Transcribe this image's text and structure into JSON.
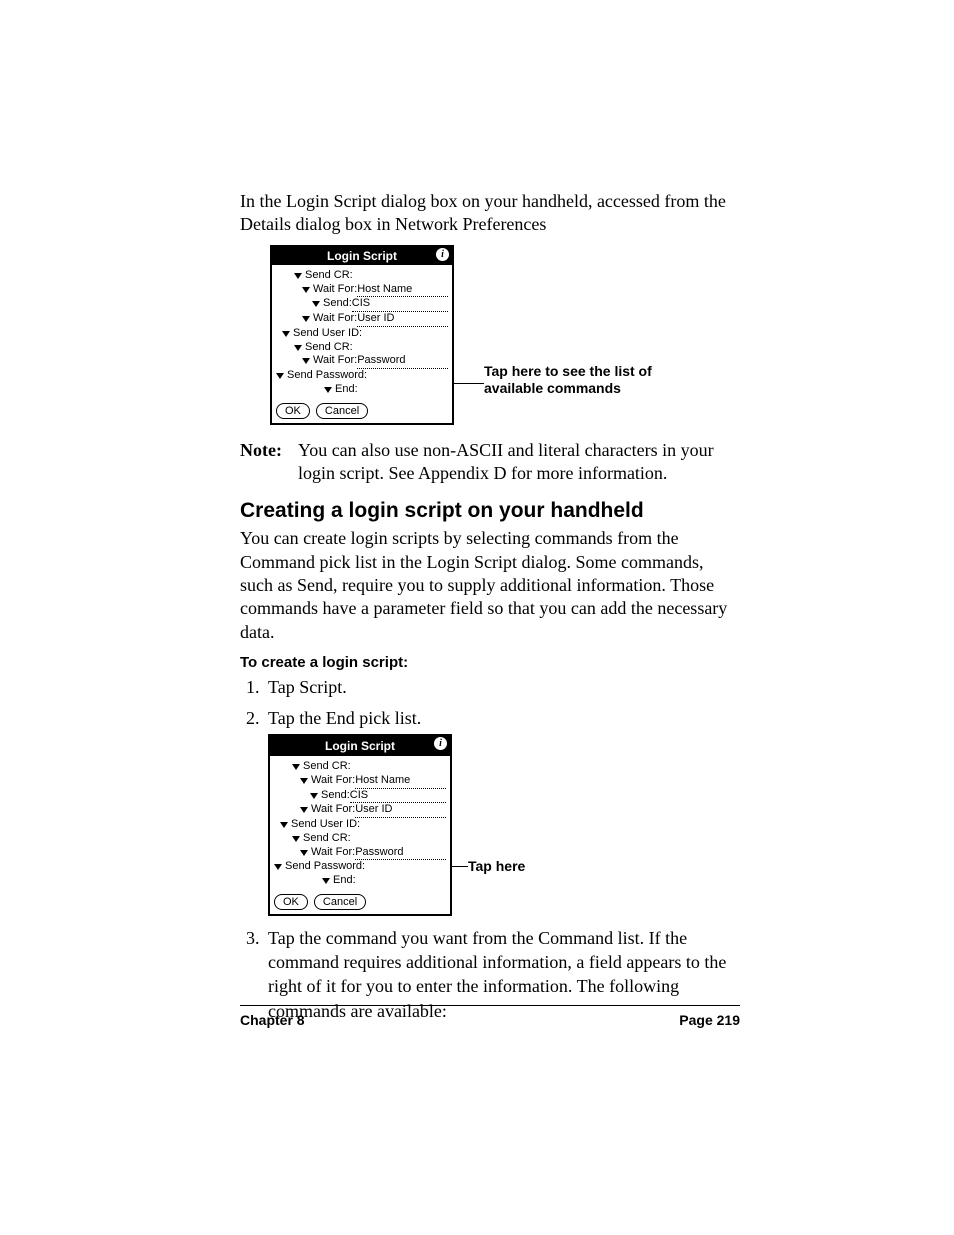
{
  "intro": "In the Login Script dialog box on your handheld, accessed from the Details dialog box in Network Preferences",
  "dialog": {
    "title": "Login Script",
    "info_glyph": "i",
    "lines": [
      {
        "indent": 18,
        "cmd": "Send CR:",
        "val": ""
      },
      {
        "indent": 26,
        "cmd": "Wait For:",
        "val": "Host Name"
      },
      {
        "indent": 36,
        "cmd": "Send:",
        "val": "CIS"
      },
      {
        "indent": 26,
        "cmd": "Wait For:",
        "val": "User ID"
      },
      {
        "indent": 6,
        "cmd": "Send User ID:",
        "val": ""
      },
      {
        "indent": 18,
        "cmd": "Send CR:",
        "val": ""
      },
      {
        "indent": 26,
        "cmd": "Wait For:",
        "val": "Password"
      },
      {
        "indent": 0,
        "cmd": "Send Password:",
        "val": ""
      },
      {
        "indent": 48,
        "cmd": "End:",
        "val": ""
      }
    ],
    "ok": "OK",
    "cancel": "Cancel"
  },
  "callout1": "Tap here to see the list of available commands",
  "note": {
    "label": "Note:",
    "text": "You can also use non-ASCII and literal characters in your login script. See Appendix D for more information."
  },
  "h2": "Creating a login script on your handheld",
  "para2": "You can create login scripts by selecting commands from the Command pick list in the Login Script dialog. Some commands, such as Send, require you to supply additional information. Those commands have a parameter field so that you can add the necessary data.",
  "h3": "To create a login script:",
  "steps": {
    "s1": "Tap Script.",
    "s2": "Tap the End pick list.",
    "s3": "Tap the command you want from the Command list. If the command requires additional information, a field appears to the right of it for you to enter the information. The following commands are available:"
  },
  "callout2": "Tap here",
  "footer": {
    "chapter": "Chapter 8",
    "page": "Page 219"
  }
}
